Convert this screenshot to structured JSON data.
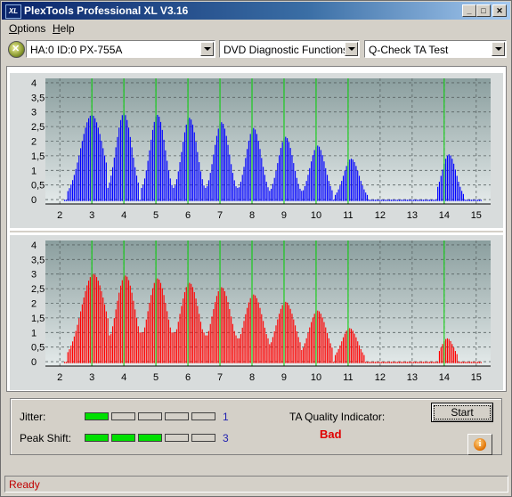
{
  "window": {
    "title": "PlexTools Professional XL V3.16",
    "icon_text": "XL",
    "minimize": "_",
    "maximize": "□",
    "close": "✕"
  },
  "menu": [
    {
      "accel": "O",
      "rest": "ptions"
    },
    {
      "accel": "H",
      "rest": "elp"
    }
  ],
  "toolbar": {
    "device": "HA:0 ID:0  PX-755A",
    "function": "DVD Diagnostic Functions",
    "test": "Q-Check TA Test"
  },
  "chart_data": [
    {
      "type": "bar",
      "name": "top",
      "color": "#0000ff",
      "xlim": [
        1.55,
        15.45
      ],
      "ylim": [
        -0.15,
        4.15
      ],
      "x_ticks": [
        2,
        3,
        4,
        5,
        6,
        7,
        8,
        9,
        10,
        11,
        12,
        13,
        14,
        15
      ],
      "y_ticks": [
        "0",
        "0,5",
        "1",
        "1,5",
        "2",
        "2,5",
        "3",
        "3,5",
        "4"
      ],
      "markers": [
        3,
        4,
        5,
        6,
        7,
        8,
        9,
        10,
        11,
        14
      ],
      "peaks": [
        {
          "center": 3.0,
          "peak": 2.9,
          "lo": 2.2,
          "hi": 3.45,
          "start": 0.0,
          "sigma": 0.35
        },
        {
          "center": 4.0,
          "peak": 2.95,
          "lo": 3.5,
          "hi": 4.48,
          "start": 0.4,
          "sigma": 0.25
        },
        {
          "center": 5.05,
          "peak": 2.9,
          "lo": 4.55,
          "hi": 5.5,
          "start": 0.4,
          "sigma": 0.24
        },
        {
          "center": 6.05,
          "peak": 2.8,
          "lo": 5.55,
          "hi": 6.5,
          "start": 0.4,
          "sigma": 0.24
        },
        {
          "center": 7.05,
          "peak": 2.65,
          "lo": 6.55,
          "hi": 7.5,
          "start": 0.4,
          "sigma": 0.24
        },
        {
          "center": 8.05,
          "peak": 2.45,
          "lo": 7.55,
          "hi": 8.5,
          "start": 0.4,
          "sigma": 0.24
        },
        {
          "center": 9.05,
          "peak": 2.15,
          "lo": 8.55,
          "hi": 9.5,
          "start": 0.3,
          "sigma": 0.24
        },
        {
          "center": 10.05,
          "peak": 1.85,
          "lo": 9.55,
          "hi": 10.5,
          "start": 0.3,
          "sigma": 0.24
        },
        {
          "center": 11.1,
          "peak": 1.4,
          "lo": 10.6,
          "hi": 11.62,
          "start": 0.0,
          "sigma": 0.24
        },
        {
          "center": 14.15,
          "peak": 1.55,
          "lo": 13.78,
          "hi": 14.62,
          "start": 0.0,
          "sigma": 0.22
        }
      ]
    },
    {
      "type": "bar",
      "name": "bottom",
      "color": "#ff0000",
      "xlim": [
        1.55,
        15.45
      ],
      "ylim": [
        -0.15,
        4.15
      ],
      "x_ticks": [
        2,
        3,
        4,
        5,
        6,
        7,
        8,
        9,
        10,
        11,
        12,
        13,
        14,
        15
      ],
      "y_ticks": [
        "0",
        "0,5",
        "1",
        "1,5",
        "2",
        "2,5",
        "3",
        "3,5",
        "4"
      ],
      "markers": [
        3,
        4,
        5,
        6,
        7,
        8,
        9,
        10,
        11,
        14
      ],
      "peaks": [
        {
          "center": 3.05,
          "peak": 3.0,
          "lo": 2.25,
          "hi": 3.5,
          "start": 0.3,
          "sigma": 0.38
        },
        {
          "center": 4.05,
          "peak": 2.95,
          "lo": 3.5,
          "hi": 4.5,
          "start": 0.9,
          "sigma": 0.3
        },
        {
          "center": 5.05,
          "peak": 2.85,
          "lo": 4.5,
          "hi": 5.5,
          "start": 1.0,
          "sigma": 0.3
        },
        {
          "center": 6.05,
          "peak": 2.7,
          "lo": 5.5,
          "hi": 6.5,
          "start": 1.0,
          "sigma": 0.3
        },
        {
          "center": 7.05,
          "peak": 2.55,
          "lo": 6.5,
          "hi": 7.5,
          "start": 0.9,
          "sigma": 0.3
        },
        {
          "center": 8.05,
          "peak": 2.3,
          "lo": 7.5,
          "hi": 8.5,
          "start": 0.8,
          "sigma": 0.3
        },
        {
          "center": 9.05,
          "peak": 2.05,
          "lo": 8.5,
          "hi": 9.5,
          "start": 0.6,
          "sigma": 0.3
        },
        {
          "center": 10.05,
          "peak": 1.75,
          "lo": 9.5,
          "hi": 10.5,
          "start": 0.4,
          "sigma": 0.28
        },
        {
          "center": 11.05,
          "peak": 1.15,
          "lo": 10.6,
          "hi": 11.5,
          "start": 0.0,
          "sigma": 0.25
        },
        {
          "center": 14.1,
          "peak": 0.8,
          "lo": 13.85,
          "hi": 14.4,
          "start": 0.0,
          "sigma": 0.2
        }
      ]
    }
  ],
  "results": {
    "jitter_label": "Jitter:",
    "jitter_value": "1",
    "jitter_level": 1,
    "peak_label": "Peak Shift:",
    "peak_value": "3",
    "peak_level": 3,
    "level_max": 5,
    "ta_label": "TA Quality Indicator:",
    "ta_result": "Bad",
    "start_label": "Start"
  },
  "status": {
    "text": "Ready"
  }
}
